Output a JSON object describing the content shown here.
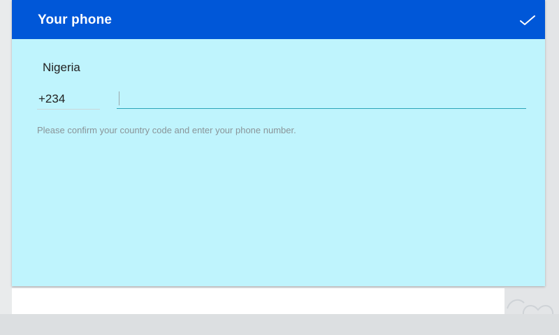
{
  "dialog": {
    "title": "Your phone",
    "confirm_icon": "check-icon",
    "country": "Nigeria",
    "country_code": "+234",
    "phone_number": "",
    "hint": "Please confirm your country code and enter your phone number."
  },
  "colors": {
    "titlebar": "#0057d8",
    "dialog_background": "#bff4fd",
    "input_underline_active": "#2ba5b8"
  }
}
